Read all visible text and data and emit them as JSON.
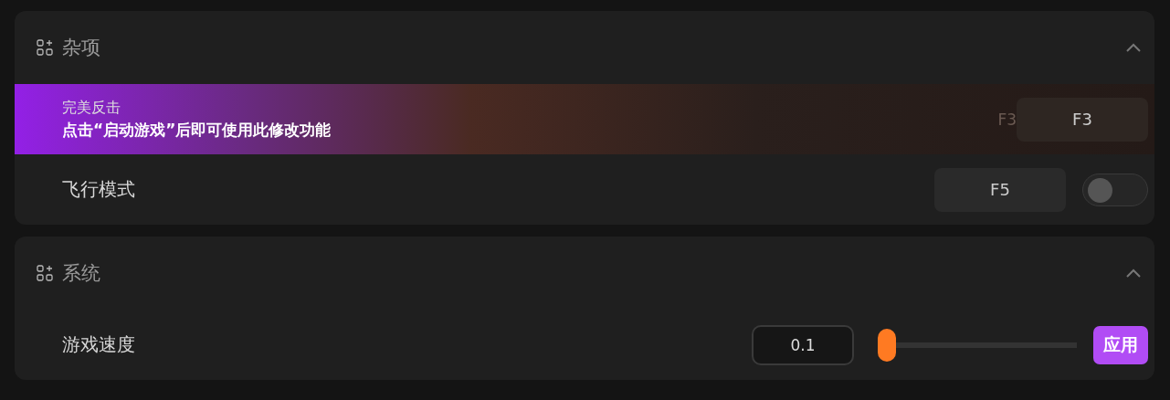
{
  "sections": [
    {
      "title": "杂项",
      "expanded": true,
      "rows": [
        {
          "kind": "locked",
          "banner_title": "完美反击",
          "banner_message": "点击“启动游戏”后即可使用此修改功能",
          "hint": "F3",
          "key": "F3"
        },
        {
          "kind": "toggle",
          "label": "飞行模式",
          "key": "F5",
          "on": false
        }
      ]
    },
    {
      "title": "系统",
      "expanded": true,
      "rows": [
        {
          "kind": "slider",
          "label": "游戏速度",
          "value": "0.1",
          "level": 0,
          "button": "应用"
        }
      ]
    }
  ]
}
